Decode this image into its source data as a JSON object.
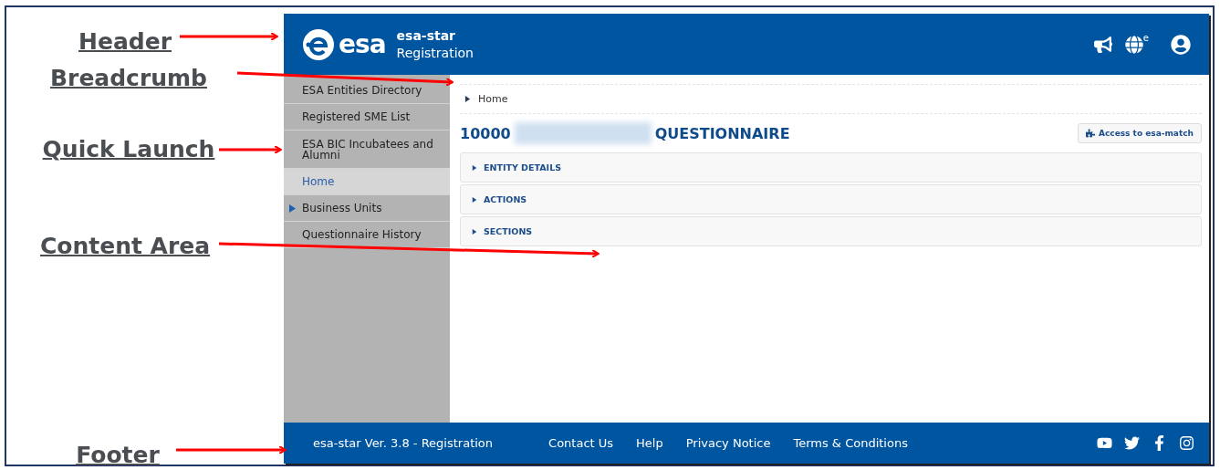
{
  "annotations": [
    "Header",
    "Breadcrumb",
    "Quick Launch",
    "Content Area",
    "Footer"
  ],
  "header": {
    "logo": "esa",
    "app_name": "esa-star",
    "app_subtitle": "Registration",
    "language_badge": "e"
  },
  "sidebar": {
    "items": [
      {
        "label": "ESA Entities Directory",
        "kind": "link",
        "selected": false
      },
      {
        "label": "Registered SME List",
        "kind": "link",
        "selected": false
      },
      {
        "label": "ESA BIC Incubatees and Alumni",
        "kind": "link",
        "selected": false
      },
      {
        "label": "Home",
        "kind": "link",
        "selected": true
      },
      {
        "label": "Business Units",
        "kind": "group",
        "selected": false
      },
      {
        "label": "Questionnaire History",
        "kind": "link",
        "selected": false
      }
    ]
  },
  "breadcrumb": [
    "Home"
  ],
  "page": {
    "id_prefix": "10000",
    "title": "QUESTIONNAIRE",
    "action_button": "Access to esa-match"
  },
  "sections": [
    {
      "label": "ENTITY DETAILS",
      "expanded": false
    },
    {
      "label": "ACTIONS",
      "expanded": false
    },
    {
      "label": "SECTIONS",
      "expanded": false
    }
  ],
  "footer": {
    "version": "esa-star Ver. 3.8 - Registration",
    "links": [
      "Contact Us",
      "Help",
      "Privacy Notice",
      "Terms & Conditions"
    ]
  }
}
